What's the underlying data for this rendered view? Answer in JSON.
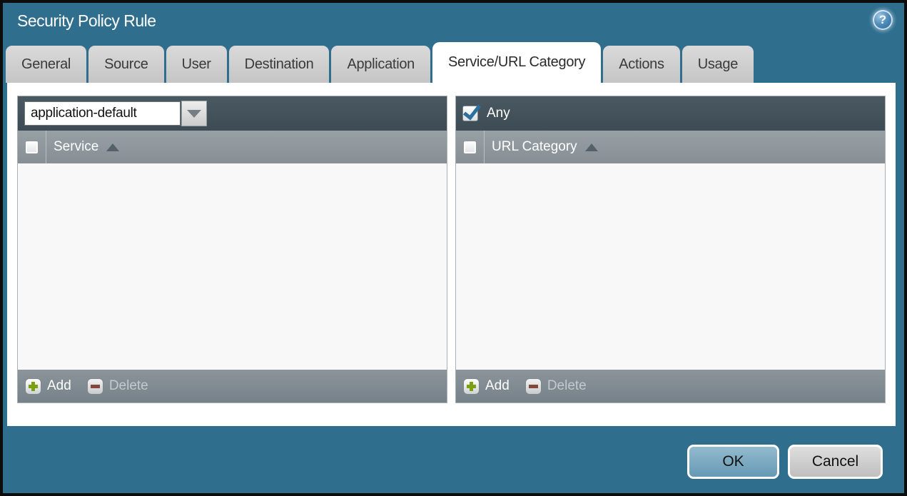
{
  "window": {
    "title": "Security Policy Rule",
    "help_icon_glyph": "?"
  },
  "tabs": [
    {
      "label": "General",
      "active": false
    },
    {
      "label": "Source",
      "active": false
    },
    {
      "label": "User",
      "active": false
    },
    {
      "label": "Destination",
      "active": false
    },
    {
      "label": "Application",
      "active": false
    },
    {
      "label": "Service/URL Category",
      "active": true
    },
    {
      "label": "Actions",
      "active": false
    },
    {
      "label": "Usage",
      "active": false
    }
  ],
  "service_panel": {
    "selector_value": "application-default",
    "column_header": "Service",
    "rows": [],
    "add_label": "Add",
    "delete_label": "Delete",
    "delete_enabled": false
  },
  "url_category_panel": {
    "any_label": "Any",
    "any_checked": true,
    "column_header": "URL Category",
    "rows": [],
    "add_label": "Add",
    "delete_label": "Delete",
    "delete_enabled": false
  },
  "action_buttons": {
    "ok": "OK",
    "cancel": "Cancel"
  },
  "colors": {
    "teal_background": "#306e8e",
    "panel_topbar": "#42505a",
    "panel_header": "#8c969b",
    "panel_footer": "#7e898a",
    "active_tab": "#ffffff",
    "ok_button": "#79a9c1",
    "check_blue": "#2d6f9e",
    "add_green": "#7ba011",
    "delete_red": "#83483b"
  }
}
